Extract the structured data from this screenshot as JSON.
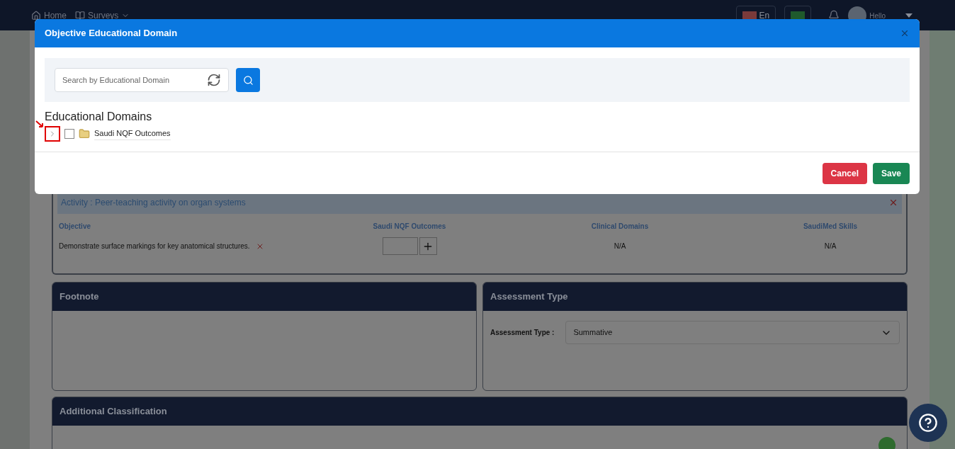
{
  "navbar": {
    "items": [
      {
        "label": "Home",
        "kind": "home"
      },
      {
        "label": "Surveys",
        "kind": "surveys"
      }
    ],
    "language": "En",
    "greeting": "Hello"
  },
  "activity": {
    "title": "Activity : Peer-teaching activity on organ systems",
    "columns": [
      "Objective",
      "Saudi NQF Outcomes",
      "Clinical Domains",
      "SaudiMed Skills"
    ],
    "rows": [
      {
        "objective": "Demonstrate surface markings for key anatomical structures.",
        "clinical_domains": "N/A",
        "saudimed_skills": "N/A"
      }
    ]
  },
  "footnote": {
    "title": "Footnote"
  },
  "assessment": {
    "title": "Assessment Type",
    "label": "Assessment Type :",
    "value": "Summative"
  },
  "additional": {
    "title": "Additional Classification"
  },
  "modal": {
    "title": "Objective Educational Domain",
    "search": {
      "placeholder": "Search by Educational Domain"
    },
    "section_title": "Educational Domains",
    "tree": [
      {
        "label": "Saudi NQF Outcomes",
        "checked": false,
        "expanded": false
      }
    ],
    "buttons": [
      {
        "label": "Cancel",
        "kind": "danger"
      },
      {
        "label": "Save",
        "kind": "primary"
      }
    ]
  }
}
